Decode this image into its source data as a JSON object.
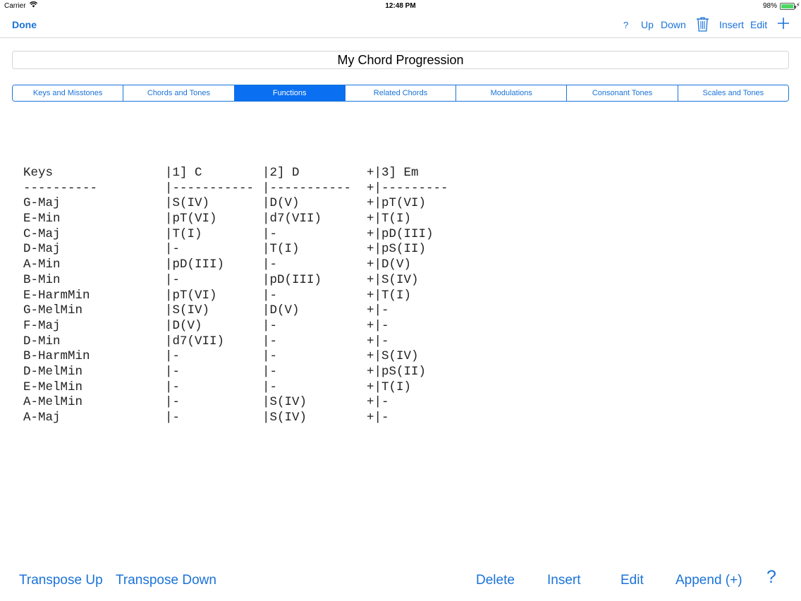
{
  "status_bar": {
    "carrier": "Carrier",
    "time": "12:48 PM",
    "battery": "98%"
  },
  "nav": {
    "done": "Done",
    "help": "?",
    "up": "Up",
    "down": "Down",
    "insert": "Insert",
    "edit": "Edit"
  },
  "title": "My Chord Progression",
  "tabs": [
    {
      "label": "Keys and Misstones"
    },
    {
      "label": "Chords and Tones"
    },
    {
      "label": "Functions",
      "active": true
    },
    {
      "label": "Related Chords"
    },
    {
      "label": "Modulations"
    },
    {
      "label": "Consonant Tones"
    },
    {
      "label": "Scales and Tones"
    }
  ],
  "table": {
    "header": [
      "Keys",
      "|1] C",
      "|2] D",
      "+|3] Em"
    ],
    "separator": [
      "----------",
      "|-----------",
      "|-----------",
      "+|---------"
    ],
    "rows": [
      [
        "G-Maj",
        "|S(IV)",
        "|D(V)",
        "+|pT(VI)"
      ],
      [
        "E-Min",
        "|pT(VI)",
        "|d7(VII)",
        "+|T(I)"
      ],
      [
        "C-Maj",
        "|T(I)",
        "|-",
        "+|pD(III)"
      ],
      [
        "D-Maj",
        "|-",
        "|T(I)",
        "+|pS(II)"
      ],
      [
        "A-Min",
        "|pD(III)",
        "|-",
        "+|D(V)"
      ],
      [
        "B-Min",
        "|-",
        "|pD(III)",
        "+|S(IV)"
      ],
      [
        "E-HarmMin",
        "|pT(VI)",
        "|-",
        "+|T(I)"
      ],
      [
        "G-MelMin",
        "|S(IV)",
        "|D(V)",
        "+|-"
      ],
      [
        "F-Maj",
        "|D(V)",
        "|-",
        "+|-"
      ],
      [
        "D-Min",
        "|d7(VII)",
        "|-",
        "+|-"
      ],
      [
        "B-HarmMin",
        "|-",
        "|-",
        "+|S(IV)"
      ],
      [
        "D-MelMin",
        "|-",
        "|-",
        "+|pS(II)"
      ],
      [
        "E-MelMin",
        "|-",
        "|-",
        "+|T(I)"
      ],
      [
        "A-MelMin",
        "|-",
        "|S(IV)",
        "+|-"
      ],
      [
        "A-Maj",
        "|-",
        "|S(IV)",
        "+|-"
      ]
    ]
  },
  "bottom": {
    "transpose_up": "Transpose Up",
    "transpose_down": "Transpose Down",
    "delete": "Delete",
    "insert": "Insert",
    "edit": "Edit",
    "append": "Append (+)",
    "help": "?"
  },
  "colors": {
    "accent": "#1a73d9",
    "active_segment": "#0a6ff0",
    "battery": "#4cd964"
  }
}
